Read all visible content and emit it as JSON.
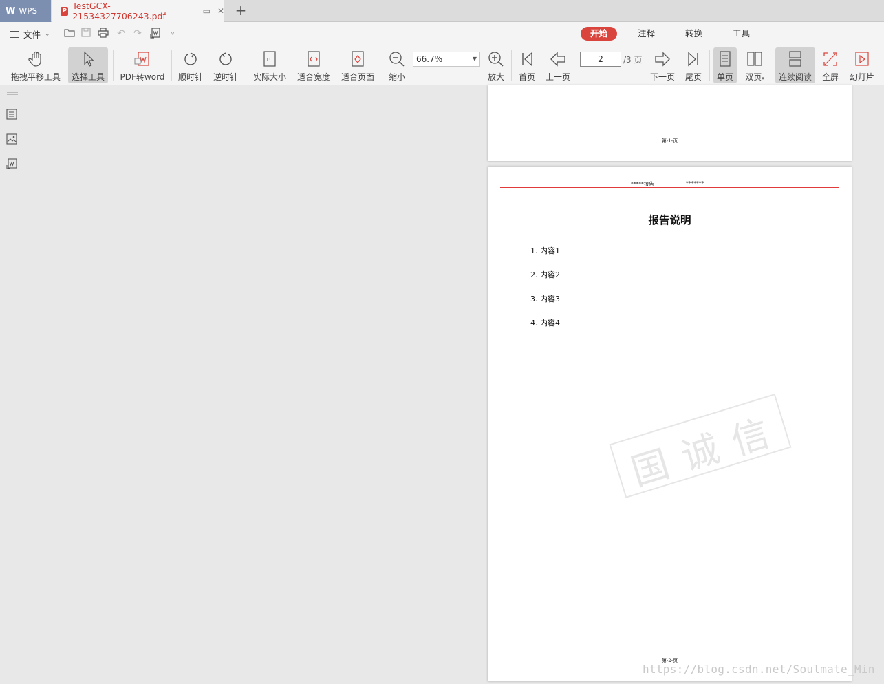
{
  "tabs": {
    "app_label": "WPS",
    "document_title": "TestGCX-21534327706243.pdf",
    "new_tab": "+"
  },
  "menu": {
    "file_label": "文件",
    "ribbon_tabs": [
      {
        "label": "开始",
        "active": true
      },
      {
        "label": "注释",
        "active": false
      },
      {
        "label": "转换",
        "active": false
      },
      {
        "label": "工具",
        "active": false
      }
    ]
  },
  "toolbar": {
    "pan_tool": "拖拽平移工具",
    "select_tool": "选择工具",
    "pdf_to_word": "PDF转word",
    "rotate_cw": "顺时针",
    "rotate_ccw": "逆时针",
    "actual_size": "实际大小",
    "fit_width": "适合宽度",
    "fit_page": "适合页面",
    "zoom_out": "缩小",
    "zoom_value": "66.7%",
    "zoom_in": "放大",
    "first_page": "首页",
    "prev_page": "上一页",
    "current_page": "2",
    "total_pages": "/3 页",
    "next_page": "下一页",
    "last_page": "尾页",
    "single_page": "单页",
    "double_page": "双页",
    "continuous": "连续阅读",
    "fullscreen": "全屏",
    "slideshow": "幻灯片"
  },
  "document": {
    "page1_footer": "第-1-页",
    "page2_header_left": "*****报告",
    "page2_header_right": "*******",
    "page2_title": "报告说明",
    "items": [
      "1. 内容1",
      "2. 内容2",
      "3. 内容3",
      "4. 内容4"
    ],
    "stamp_text": "国诚信",
    "page2_footer": "第-2-页"
  },
  "watermark": "https://blog.csdn.net/Soulmate_Min",
  "colors": {
    "accent": "#d9453d",
    "header_rule": "#e23a3a"
  }
}
